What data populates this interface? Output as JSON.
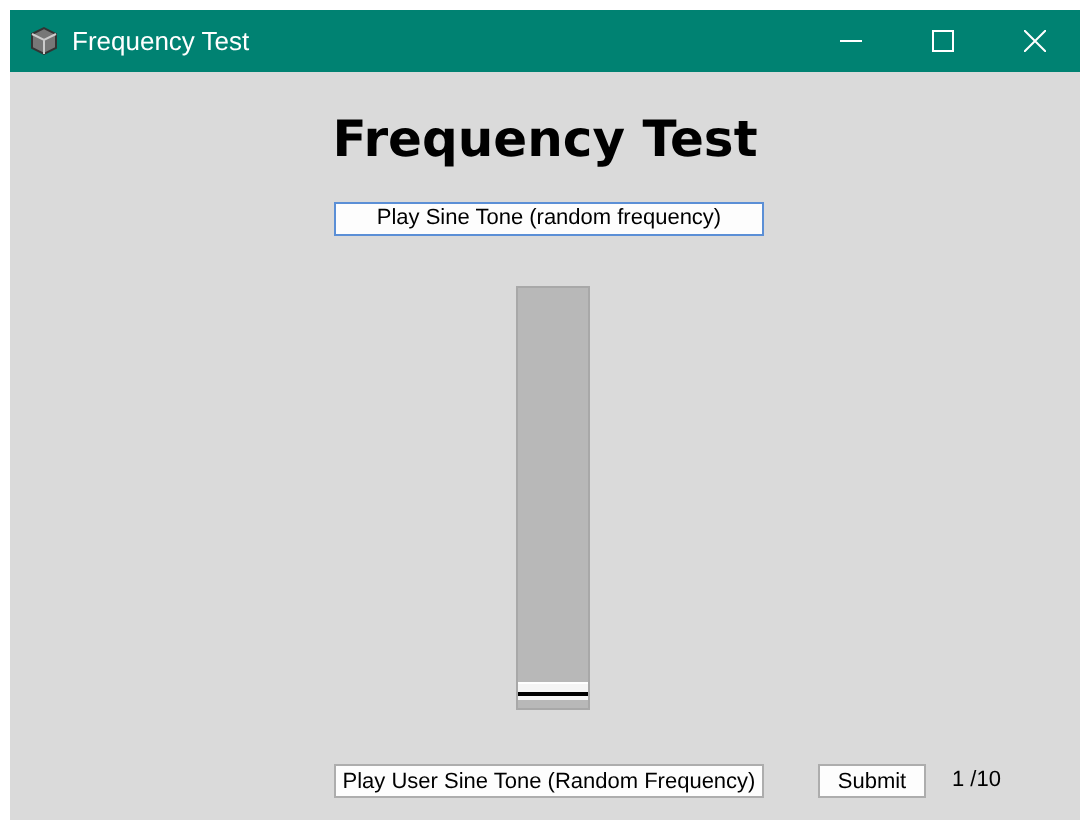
{
  "window": {
    "title": "Frequency Test"
  },
  "heading": "Frequency Test",
  "play_button": {
    "label": "Play Sine Tone (random frequency)",
    "focused": true
  },
  "slider": {
    "level": 0.02
  },
  "user_tone_button": {
    "label": "Play User Sine Tone (Random Frequency)"
  },
  "submit_button": {
    "label": "Submit"
  },
  "progress": "1 /10"
}
